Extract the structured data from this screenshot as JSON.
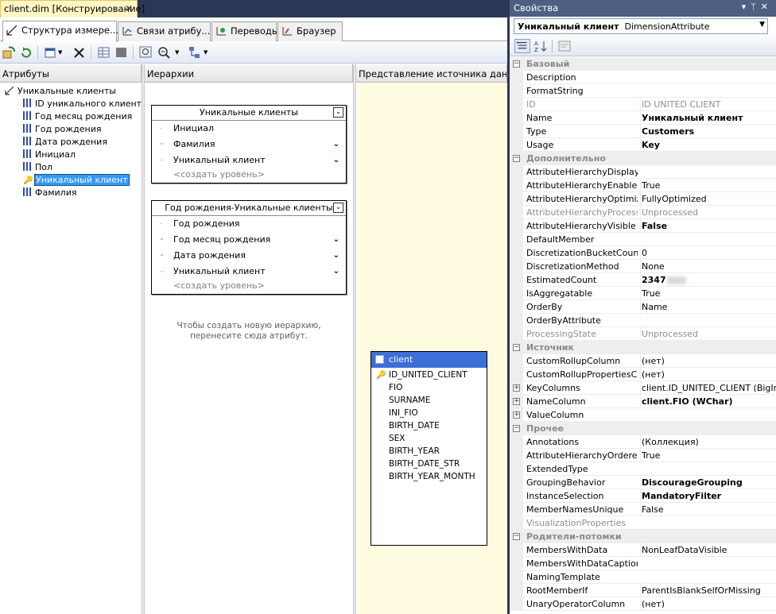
{
  "doc_tab": {
    "title": "client.dim [Конструирование]"
  },
  "designer_tabs": [
    {
      "label": "Структура измере..."
    },
    {
      "label": "Связи атрибу..."
    },
    {
      "label": "Переводы"
    },
    {
      "label": "Браузер"
    }
  ],
  "panes": {
    "attributes": "Атрибуты",
    "hierarchies": "Иерархии",
    "dsv": "Представление источника данных"
  },
  "attributes": {
    "root": "Уникальные клиенты",
    "items": [
      "ID уникального клиента",
      "Год месяц рождения",
      "Год рождения",
      "Дата рождения",
      "Инициал",
      "Пол",
      "Уникальный клиент",
      "Фамилия"
    ]
  },
  "hierarchies": [
    {
      "title": "Уникальные клиенты",
      "levels": [
        "Инициал",
        "Фамилия",
        "Уникальный клиент"
      ]
    },
    {
      "title": "Год рождения-Уникальные клиенты",
      "levels": [
        "Год рождения",
        "Год месяц рождения",
        "Дата рождения",
        "Уникальный клиент"
      ]
    }
  ],
  "create_level": "<создать уровень>",
  "hier_hint": "Чтобы создать новую иерархию, перенесите сюда атрибут.",
  "dsv_table": {
    "name": "client",
    "columns": [
      "ID_UNITED_CLIENT",
      "FIO",
      "SURNAME",
      "INI_FIO",
      "BIRTH_DATE",
      "SEX",
      "BIRTH_YEAR",
      "BIRTH_DATE_STR",
      "BIRTH_YEAR_MONTH"
    ]
  },
  "properties": {
    "title": "Свойства",
    "object": "Уникальный клиент",
    "object_type": "DimensionAttribute",
    "rows": [
      {
        "kind": "cat",
        "name": "Базовый"
      },
      {
        "name": "Description",
        "value": ""
      },
      {
        "name": "FormatString",
        "value": ""
      },
      {
        "name": "ID",
        "value": "ID UNITED CLIENT",
        "dis": true
      },
      {
        "name": "Name",
        "value": "Уникальный клиент",
        "bold": true
      },
      {
        "name": "Type",
        "value": "Customers",
        "bold": true
      },
      {
        "name": "Usage",
        "value": "Key",
        "bold": true
      },
      {
        "kind": "cat",
        "name": "Дополнительно"
      },
      {
        "name": "AttributeHierarchyDisplayFolder",
        "value": ""
      },
      {
        "name": "AttributeHierarchyEnabled",
        "value": "True"
      },
      {
        "name": "AttributeHierarchyOptimizedState",
        "value": "FullyOptimized"
      },
      {
        "name": "AttributeHierarchyProcessingState",
        "value": "Unprocessed",
        "dis": true
      },
      {
        "name": "AttributeHierarchyVisible",
        "value": "False",
        "bold": true
      },
      {
        "name": "DefaultMember",
        "value": ""
      },
      {
        "name": "DiscretizationBucketCount",
        "value": "0"
      },
      {
        "name": "DiscretizationMethod",
        "value": "None"
      },
      {
        "name": "EstimatedCount",
        "value": "2347",
        "bold": true,
        "blur": true
      },
      {
        "name": "IsAggregatable",
        "value": "True"
      },
      {
        "name": "OrderBy",
        "value": "Name"
      },
      {
        "name": "OrderByAttribute",
        "value": ""
      },
      {
        "name": "ProcessingState",
        "value": "Unprocessed",
        "dis": true
      },
      {
        "kind": "cat",
        "name": "Источник"
      },
      {
        "name": "CustomRollupColumn",
        "value": "(нет)"
      },
      {
        "name": "CustomRollupPropertiesColumn",
        "value": "(нет)"
      },
      {
        "name": "KeyColumns",
        "value": "client.ID_UNITED_CLIENT (BigInt)",
        "exp": true
      },
      {
        "name": "NameColumn",
        "value": "client.FIO (WChar)",
        "bold": true,
        "exp": true
      },
      {
        "name": "ValueColumn",
        "value": "",
        "exp": true
      },
      {
        "kind": "cat",
        "name": "Прочее"
      },
      {
        "name": "Annotations",
        "value": "(Коллекция)"
      },
      {
        "name": "AttributeHierarchyOrdered",
        "value": "True"
      },
      {
        "name": "ExtendedType",
        "value": ""
      },
      {
        "name": "GroupingBehavior",
        "value": "DiscourageGrouping",
        "bold": true
      },
      {
        "name": "InstanceSelection",
        "value": "MandatoryFilter",
        "bold": true
      },
      {
        "name": "MemberNamesUnique",
        "value": "False"
      },
      {
        "name": "VisualizationProperties",
        "value": "",
        "dis": true
      },
      {
        "kind": "cat",
        "name": "Родители-потомки"
      },
      {
        "name": "MembersWithData",
        "value": "NonLeafDataVisible"
      },
      {
        "name": "MembersWithDataCaption",
        "value": ""
      },
      {
        "name": "NamingTemplate",
        "value": ""
      },
      {
        "name": "RootMemberIf",
        "value": "ParentIsBlankSelfOrMissing"
      },
      {
        "name": "UnaryOperatorColumn",
        "value": "(нет)"
      }
    ]
  }
}
